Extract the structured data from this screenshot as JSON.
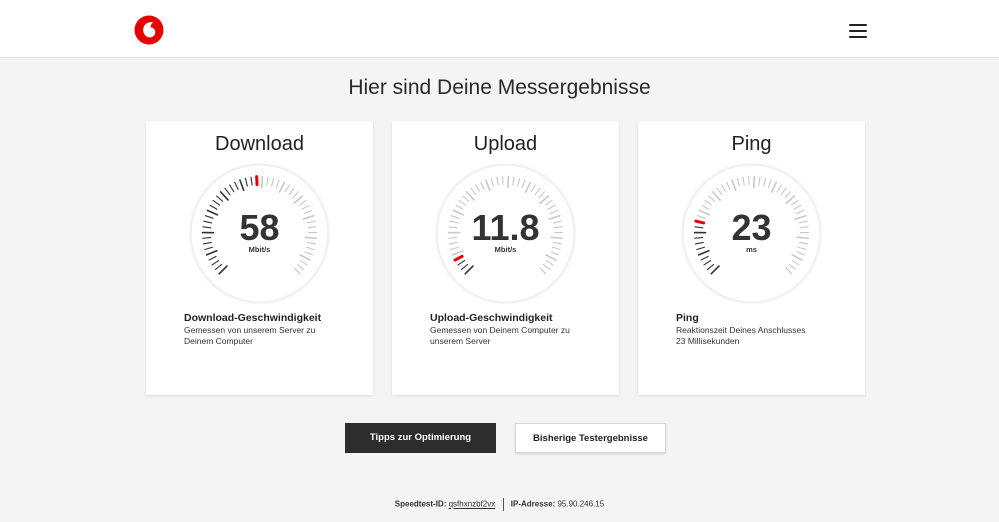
{
  "header": {
    "logo": "vodafone-logo",
    "menu_icon": "hamburger-menu-icon"
  },
  "page": {
    "title": "Hier sind Deine Messergebnisse"
  },
  "results": [
    {
      "title": "Download",
      "value": "58",
      "unit": "Mbit/s",
      "gauge_position": 0.48,
      "heading": "Download-Geschwindigkeit",
      "desc_line1": "Gemessen von unserem Server zu",
      "desc_line2": "Deinem Computer"
    },
    {
      "title": "Upload",
      "value": "11.8",
      "unit": "Mbit/s",
      "gauge_position": 0.06,
      "heading": "Upload-Geschwindigkeit",
      "desc_line1": "Gemessen von Deinem Computer zu",
      "desc_line2": "unserem Server"
    },
    {
      "title": "Ping",
      "value": "23",
      "unit": "ms",
      "gauge_position": 0.22,
      "heading": "Ping",
      "desc_line1": "Reaktionszeit Deines Anschlusses",
      "desc_line2": "23 Millisekunden"
    }
  ],
  "buttons": {
    "primary": "Tipps zur Optimierung",
    "secondary": "Bisherige Testergebnisse"
  },
  "footer": {
    "speedtest_label": "Speedtest-ID:",
    "speedtest_id": "qsfhxnzbf2vx",
    "ip_label": "IP-Adresse:",
    "ip_value": "95.90.246.15"
  },
  "colors": {
    "brand_red": "#e60000",
    "tick_dark": "#333333",
    "tick_light": "#c8c8c8",
    "primary_button": "#2d2d2d"
  }
}
